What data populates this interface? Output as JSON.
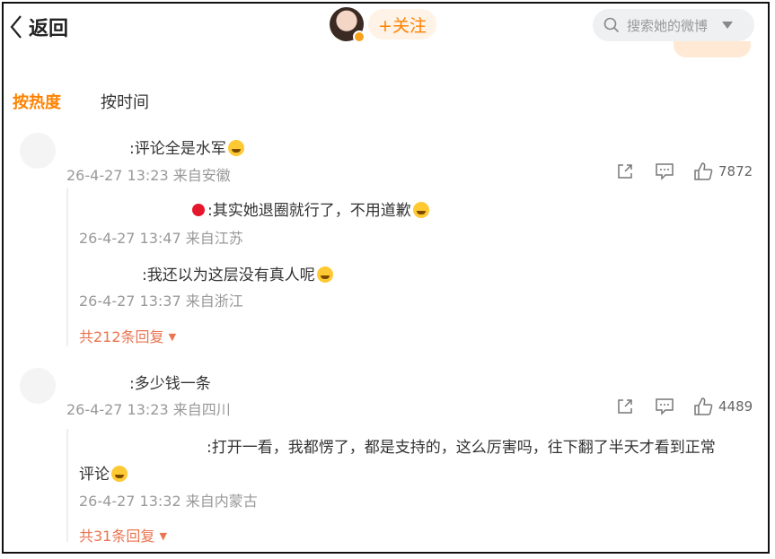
{
  "header": {
    "back_label": "返回",
    "follow_label": "+关注",
    "search_placeholder": "搜索她的微博"
  },
  "sort_tabs": [
    {
      "label": "按热度",
      "active": true
    },
    {
      "label": "按时间",
      "active": false
    }
  ],
  "comments": [
    {
      "text": ":评论全是水军",
      "meta": "26-4-27 13:23 来自安徽",
      "likes": "7872",
      "replies": [
        {
          "text": ":其实她退圈就行了，不用道歉",
          "meta": "26-4-27 13:47 来自江苏"
        },
        {
          "text": ":我还以为这层没有真人呢",
          "meta": "26-4-27 13:37 来自浙江"
        }
      ],
      "more_replies": "共212条回复"
    },
    {
      "text": ":多少钱一条",
      "meta": "26-4-27 13:23 来自四川",
      "likes": "4489",
      "replies": [
        {
          "text_line1": ":打开一看，我都愣了，都是支持的，这么厉害吗，往下翻了半天才看到正常",
          "text_line2": "评论",
          "meta": "26-4-27 13:32 来自内蒙古"
        }
      ],
      "more_replies": "共31条回复"
    }
  ],
  "colors": {
    "accent": "#ff8200",
    "link": "#eb7350",
    "meta": "#999999"
  },
  "icons": [
    "chevron-left-icon",
    "search-icon",
    "caret-down-icon",
    "share-icon",
    "comment-icon",
    "like-icon",
    "emoji-icon",
    "verified-badge-icon"
  ]
}
